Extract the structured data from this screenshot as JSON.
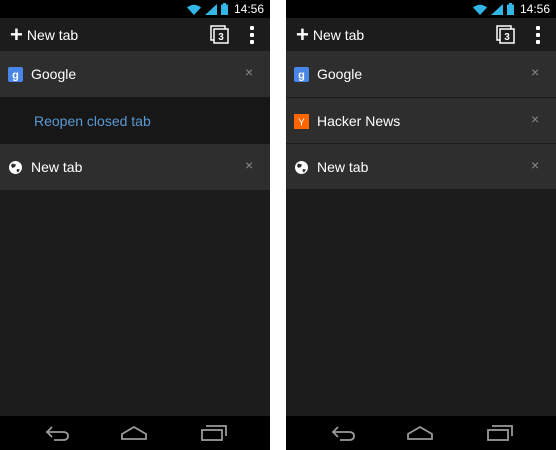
{
  "status_bar": {
    "time": "14:56"
  },
  "action_bar": {
    "new_tab_label": "New tab",
    "tab_count": "3"
  },
  "left_phone": {
    "tabs": [
      {
        "title": "Google",
        "favicon": "google-favicon-icon"
      },
      {
        "title": "New tab",
        "favicon": "globe-icon"
      }
    ],
    "reopen_label": "Reopen closed tab"
  },
  "right_phone": {
    "tabs": [
      {
        "title": "Google",
        "favicon": "google-favicon-icon"
      },
      {
        "title": "Hacker News",
        "favicon": "hacker-news-favicon-icon"
      },
      {
        "title": "New tab",
        "favicon": "globe-icon"
      }
    ]
  },
  "colors": {
    "background": "#1c1c1c",
    "tab_row": "#2e2e2e",
    "reopen_link": "#5a9ad4",
    "google_blue": "#4a86e8",
    "hacker_news_orange": "#ff6600"
  },
  "icons": {
    "close": "×",
    "back": "back-icon",
    "home": "home-icon",
    "recent_apps": "recent-apps-icon"
  }
}
